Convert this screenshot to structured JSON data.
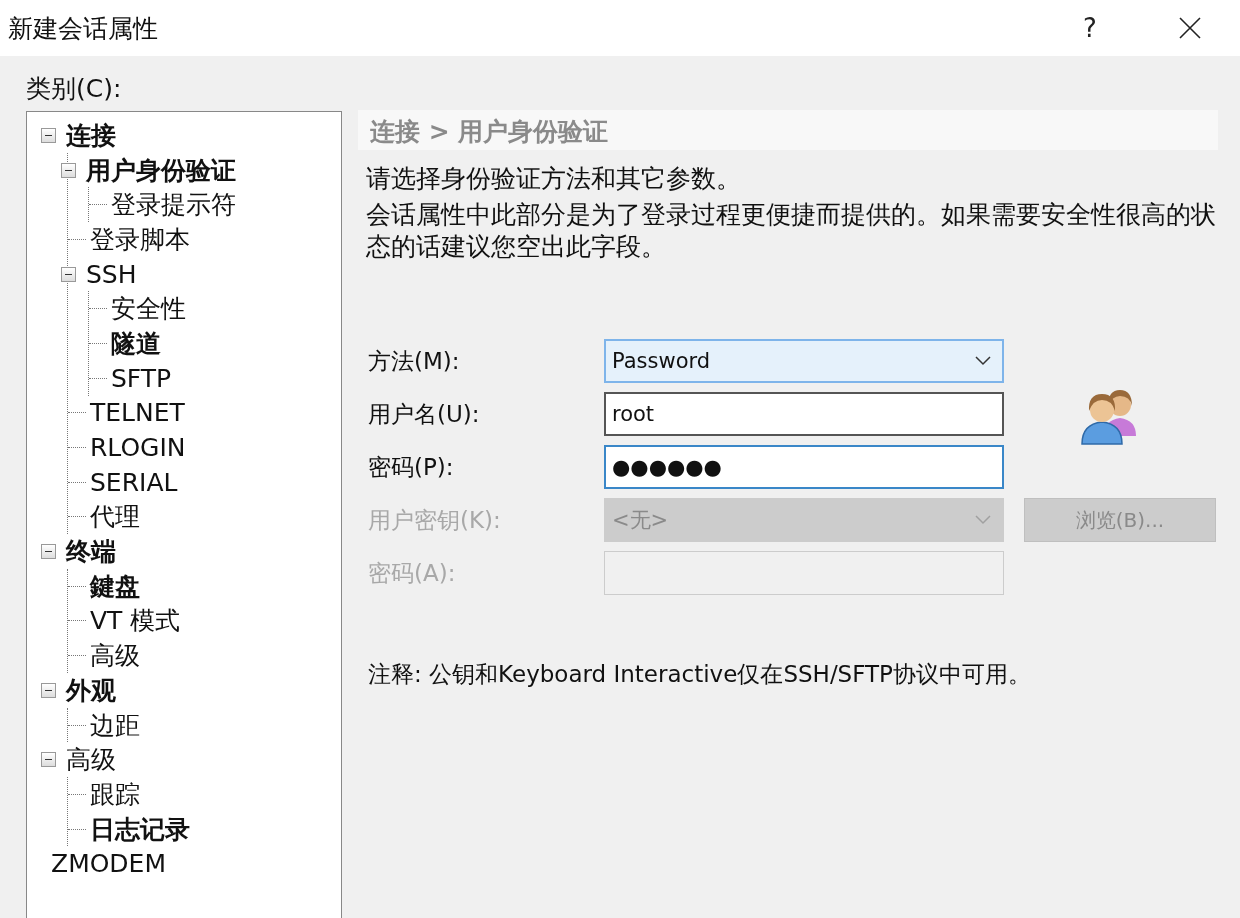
{
  "window": {
    "title": "新建会话属性",
    "help": "?"
  },
  "category_label": "类别(C):",
  "tree": [
    {
      "label": "连接",
      "bold": true,
      "expanded": true,
      "children": [
        {
          "label": "用户身份验证",
          "bold": true,
          "expanded": true,
          "children": [
            {
              "label": "登录提示符",
              "bold": false
            }
          ]
        },
        {
          "label": "登录脚本",
          "bold": false
        },
        {
          "label": "SSH",
          "bold": false,
          "expanded": true,
          "children": [
            {
              "label": "安全性",
              "bold": false
            },
            {
              "label": "隧道",
              "bold": true
            },
            {
              "label": "SFTP",
              "bold": false
            }
          ]
        },
        {
          "label": "TELNET",
          "bold": false
        },
        {
          "label": "RLOGIN",
          "bold": false
        },
        {
          "label": "SERIAL",
          "bold": false
        },
        {
          "label": "代理",
          "bold": false
        }
      ]
    },
    {
      "label": "终端",
      "bold": true,
      "expanded": true,
      "children": [
        {
          "label": "鍵盘",
          "bold": true
        },
        {
          "label": "VT 模式",
          "bold": false
        },
        {
          "label": "高级",
          "bold": false
        }
      ]
    },
    {
      "label": "外观",
      "bold": true,
      "expanded": true,
      "children": [
        {
          "label": "边距",
          "bold": false
        }
      ]
    },
    {
      "label": "高级",
      "bold": false,
      "expanded": true,
      "children": [
        {
          "label": "跟踪",
          "bold": false
        },
        {
          "label": "日志记录",
          "bold": true
        }
      ]
    },
    {
      "label": "ZMODEM",
      "bold": false
    }
  ],
  "panel": {
    "breadcrumb": "连接 > 用户身份验证",
    "intro": "请选择身份验证方法和其它参数。",
    "description": "会话属性中此部分是为了登录过程更便捷而提供的。如果需要安全性很高的状态的话建议您空出此字段。",
    "fields": [
      {
        "kind": "dropdown",
        "label": "方法(M):",
        "value": "Password",
        "disabled": false
      },
      {
        "kind": "text",
        "label": "用户名(U):",
        "value": "root",
        "disabled": false
      },
      {
        "kind": "text",
        "label": "密码(P):",
        "value": "●●●●●●",
        "disabled": false,
        "focused": true
      },
      {
        "kind": "dropdown",
        "label": "用户密钥(K):",
        "value": "<无>",
        "disabled": true,
        "button": "浏览(B)..."
      },
      {
        "kind": "text",
        "label": "密码(A):",
        "disabled": true
      }
    ],
    "note": "注释: 公钥和Keyboard Interactive仅在SSH/SFTP协议中可用。"
  }
}
